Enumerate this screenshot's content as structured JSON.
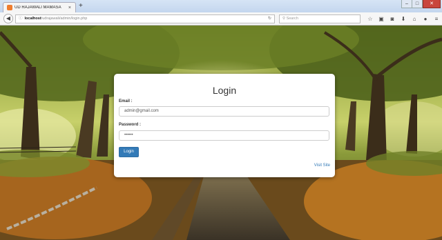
{
  "browser": {
    "tab_title": "UD RAJAWALI MAMASA",
    "tab_close": "×",
    "new_tab": "+",
    "win_minimize": "–",
    "win_maximize": "□",
    "win_close": "✕",
    "url_host": "localhost",
    "url_path": "/udrajawali/admin/login.php",
    "search_placeholder": "Search",
    "toolbar_icons": [
      "star-icon",
      "clipboard-icon",
      "pocket-icon",
      "download-icon",
      "home-icon",
      "chat-icon",
      "menu-icon"
    ]
  },
  "login": {
    "title": "Login",
    "email_label": "Email :",
    "email_value": "admin@gmail.com",
    "password_label": "Password :",
    "password_value": "••••••",
    "submit_label": "Login",
    "visit_site": "Visit Site"
  },
  "colors": {
    "primary": "#337ab7",
    "firefox_close": "#c9463d"
  }
}
